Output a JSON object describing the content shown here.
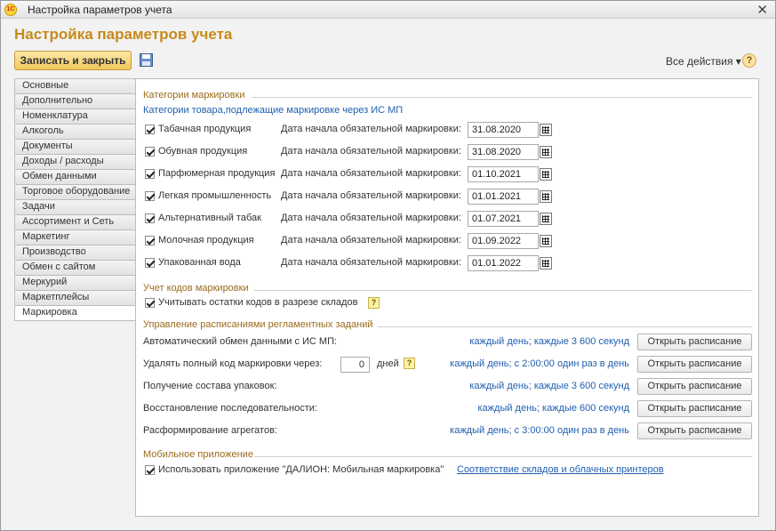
{
  "window": {
    "app_logo": "1С",
    "title": "Настройка параметров учета",
    "close_glyph": "✕"
  },
  "header": {
    "form_title": "Настройка параметров учета",
    "save_close_label": "Записать и закрыть",
    "all_actions_label": "Все действия ▾",
    "help_label": "?"
  },
  "tabs": [
    {
      "label": "Основные"
    },
    {
      "label": "Дополнительно"
    },
    {
      "label": "Номенклатура"
    },
    {
      "label": "Алкоголь"
    },
    {
      "label": "Документы"
    },
    {
      "label": "Доходы / расходы"
    },
    {
      "label": "Обмен данными"
    },
    {
      "label": "Торговое оборудование"
    },
    {
      "label": "Задачи"
    },
    {
      "label": "Ассортимент и Сеть"
    },
    {
      "label": "Маркетинг"
    },
    {
      "label": "Производство"
    },
    {
      "label": "Обмен с сайтом"
    },
    {
      "label": "Меркурий"
    },
    {
      "label": "Маркетплейсы"
    },
    {
      "label": "Маркировка"
    }
  ],
  "active_tab": "Маркировка",
  "categories": {
    "title": "Категории маркировки",
    "subtitle": "Категории товара,подлежащие маркировке через ИС МП",
    "date_label": "Дата начала обязательной маркировки:",
    "items": [
      {
        "label": "Табачная продукция",
        "checked": true,
        "date": "31.08.2020"
      },
      {
        "label": "Обувная продукция",
        "checked": true,
        "date": "31.08.2020"
      },
      {
        "label": "Парфюмерная продукция",
        "checked": true,
        "date": "01.10.2021"
      },
      {
        "label": "Легкая промышленность",
        "checked": true,
        "date": "01.01.2021"
      },
      {
        "label": "Альтернативный табак",
        "checked": true,
        "date": "01.07.2021"
      },
      {
        "label": "Молочная продукция",
        "checked": true,
        "date": "01.09.2022"
      },
      {
        "label": "Упакованная вода",
        "checked": true,
        "date": "01.01.2022"
      }
    ]
  },
  "codes": {
    "title": "Учет кодов маркировки",
    "warehouse_label": "Учитывать остатки кодов в разрезе складов",
    "warehouse_checked": true,
    "hint": "?"
  },
  "schedules": {
    "title": "Управление расписаниями регламентных заданий",
    "button_label": "Открыть расписание",
    "days_value": "0",
    "days_unit": "дней",
    "hint": "?",
    "rows": [
      {
        "label": "Автоматический обмен данными с ИС МП:",
        "schedule": "каждый день; каждые 3 600 секунд"
      },
      {
        "label": "Удалять полный код маркировки через:",
        "schedule": "каждый день; с 2:00:00 один раз в день"
      },
      {
        "label": "Получение состава упаковок:",
        "schedule": "каждый день; каждые 3 600 секунд"
      },
      {
        "label": "Восстановление последовательности:",
        "schedule": "каждый день; каждые 600 секунд"
      },
      {
        "label": "Расформирование агрегатов:",
        "schedule": "каждый день; с 3:00:00 один раз в день"
      }
    ]
  },
  "mobile": {
    "title": "Мобильное приложение",
    "use_app_label": "Использовать приложение \"ДАЛИОН: Мобильная маркировка\"",
    "use_app_checked": true,
    "link_label": "Соответствие складов и облачных принтеров"
  }
}
